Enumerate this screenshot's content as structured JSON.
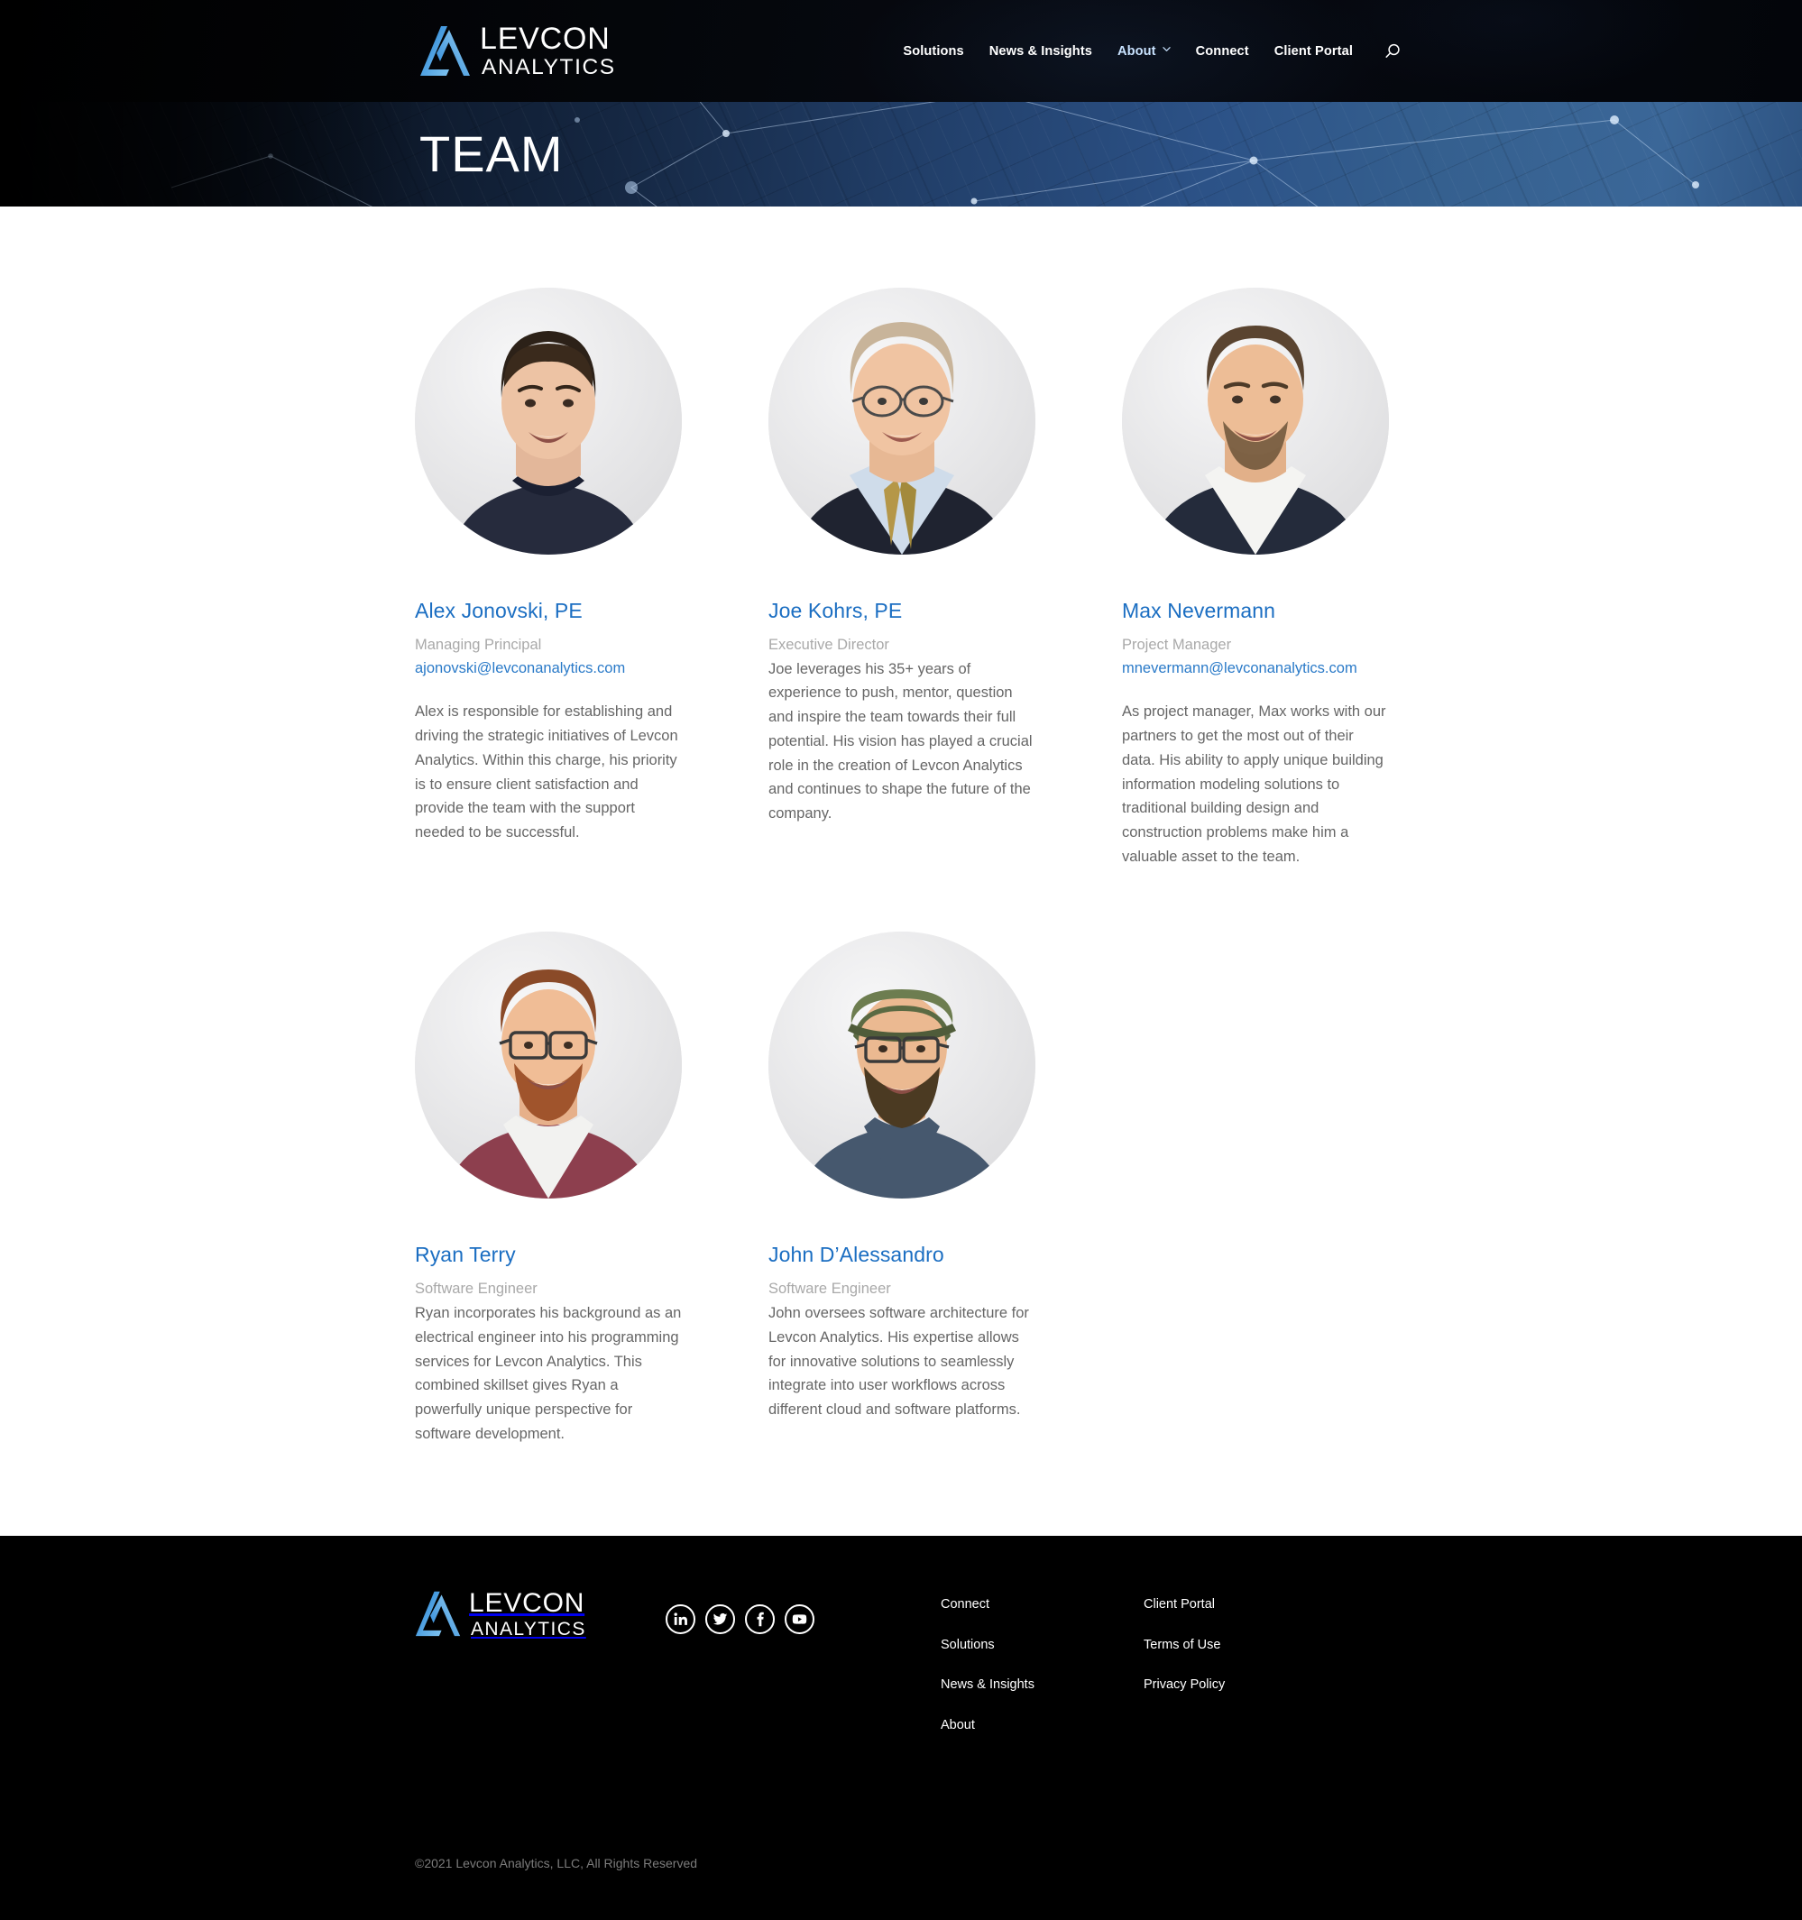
{
  "brand": {
    "logo_primary": "LEVCON",
    "logo_secondary": "ANALYTICS",
    "accent_blue": "#2a7ac8",
    "name_blue": "#1b6ec2",
    "role_gray": "#a9a9a9",
    "body_gray": "#666666"
  },
  "header": {
    "nav": [
      {
        "label": "Solutions",
        "active": false,
        "has_caret": false
      },
      {
        "label": "News & Insights",
        "active": false,
        "has_caret": false
      },
      {
        "label": "About",
        "active": true,
        "has_caret": true
      },
      {
        "label": "Connect",
        "active": false,
        "has_caret": false
      },
      {
        "label": "Client Portal",
        "active": false,
        "has_caret": false
      }
    ],
    "search_icon": "search-icon"
  },
  "hero": {
    "title": "TEAM"
  },
  "team": {
    "members": [
      {
        "name": "Alex Jonovski, PE",
        "role": "Managing Principal",
        "email": "ajonovski@levconanalytics.com",
        "bio": "Alex is responsible for establishing and driving the strategic initiatives of Levcon Analytics. Within this charge, his priority is to ensure client satisfaction and provide the team with the support needed to be successful."
      },
      {
        "name": "Joe Kohrs, PE",
        "role": "Executive Director",
        "email": "",
        "bio": "Joe leverages his 35+ years of experience to push, mentor, question and inspire the team towards their full potential. His vision has played a crucial role in the creation of Levcon Analytics and continues to shape the future of the company."
      },
      {
        "name": "Max Nevermann",
        "role": "Project Manager",
        "email": "mnevermann@levconanalytics.com",
        "bio": "As project manager, Max works with our partners to get the most out of their data. His ability to apply unique building information modeling solutions to traditional building design and construction problems make him a valuable asset to the team."
      },
      {
        "name": "Ryan Terry",
        "role": "Software Engineer",
        "email": "",
        "bio": "Ryan incorporates his background as an electrical engineer into his programming services for Levcon Analytics. This combined skillset gives Ryan a powerfully unique perspective for software development."
      },
      {
        "name": "John D’Alessandro",
        "role": "Software Engineer",
        "email": "",
        "bio": "John oversees software architecture for Levcon Analytics. His expertise allows for innovative solutions to seamlessly integrate into user workflows across different cloud and software platforms."
      }
    ]
  },
  "footer": {
    "social": [
      {
        "name": "linkedin-icon",
        "label": "LinkedIn"
      },
      {
        "name": "twitter-icon",
        "label": "Twitter"
      },
      {
        "name": "facebook-icon",
        "label": "Facebook"
      },
      {
        "name": "youtube-icon",
        "label": "YouTube"
      }
    ],
    "column_one": [
      "Connect",
      "Solutions",
      "News & Insights",
      "About"
    ],
    "column_two": [
      "Client Portal",
      "Terms of Use",
      "Privacy Policy"
    ],
    "copyright": "©2021 Levcon Analytics, LLC, All Rights Reserved"
  }
}
